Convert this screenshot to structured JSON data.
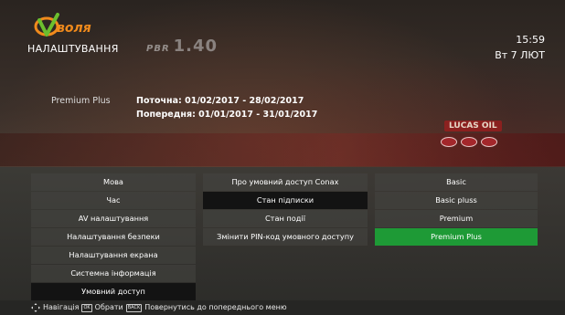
{
  "header": {
    "logo_text": "воля",
    "title": "НАЛАШТУВАННЯ",
    "time": "15:59",
    "date": "Вт 7 ЛЮТ",
    "background_score": "1.40"
  },
  "package": {
    "name": "Premium Plus",
    "current_period": "Поточна: 01/02/2017 - 28/02/2017",
    "previous_period": "Попередня: 01/01/2017 - 31/01/2017"
  },
  "background": {
    "sponsor": "LUCAS OIL"
  },
  "menu": {
    "main": [
      {
        "label": "Мова"
      },
      {
        "label": "Час"
      },
      {
        "label": "AV налаштування"
      },
      {
        "label": "Налаштування безпеки"
      },
      {
        "label": "Налаштування екрана"
      },
      {
        "label": "Системна інформація"
      },
      {
        "label": "Умовний доступ"
      }
    ],
    "sub": [
      {
        "label": "Про умовний доступ Conax"
      },
      {
        "label": "Стан підписки"
      },
      {
        "label": "Стан події"
      },
      {
        "label": "Змінити PIN-код умовного доступу"
      }
    ],
    "packages": [
      {
        "label": "Basic"
      },
      {
        "label": "Basic pluss"
      },
      {
        "label": "Premium"
      },
      {
        "label": "Premium Plus"
      }
    ]
  },
  "footer": {
    "navigate": "Навігація",
    "ok_key": "OK",
    "select": "Обрати",
    "back_key": "BACK",
    "back": "Повернутись до попереднього меню"
  },
  "colors": {
    "active_green": "#1e9a36",
    "selected_dark": "#131313",
    "logo_orange": "#f08a1c",
    "logo_green": "#6cbf2e"
  }
}
